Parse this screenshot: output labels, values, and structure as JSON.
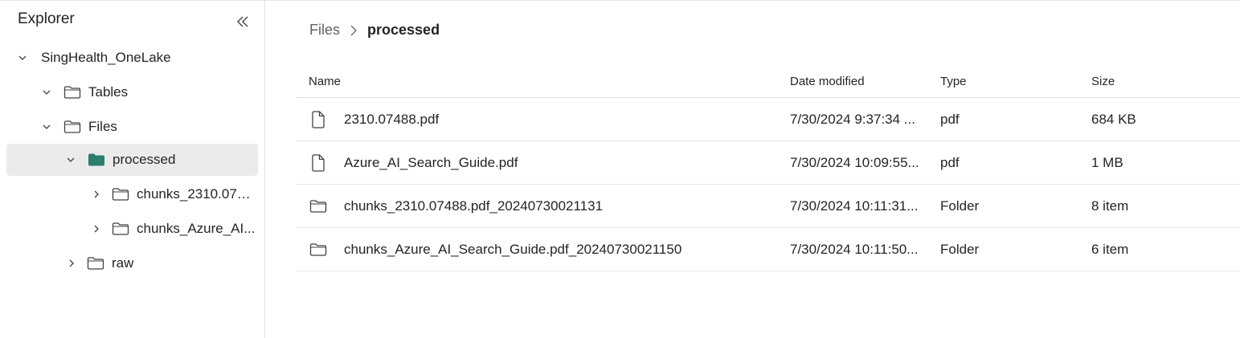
{
  "sidebar": {
    "title": "Explorer",
    "tree": [
      {
        "label": "SingHealth_OneLake",
        "expanded": true,
        "kind": "workspace"
      },
      {
        "label": "Tables",
        "expanded": true,
        "kind": "folder"
      },
      {
        "label": "Files",
        "expanded": true,
        "kind": "folder"
      },
      {
        "label": "processed",
        "expanded": true,
        "kind": "folder-filled",
        "selected": true
      },
      {
        "label": "chunks_2310.074...",
        "expanded": false,
        "kind": "folder"
      },
      {
        "label": "chunks_Azure_AI...",
        "expanded": false,
        "kind": "folder"
      },
      {
        "label": "raw",
        "expanded": false,
        "kind": "folder"
      }
    ]
  },
  "breadcrumb": {
    "root": "Files",
    "current": "processed"
  },
  "table": {
    "headers": {
      "name": "Name",
      "date": "Date modified",
      "type": "Type",
      "size": "Size"
    },
    "rows": [
      {
        "icon": "file-icon",
        "name": "2310.07488.pdf",
        "date": "7/30/2024 9:37:34 ...",
        "type": "pdf",
        "size": "684 KB"
      },
      {
        "icon": "file-icon",
        "name": "Azure_AI_Search_Guide.pdf",
        "date": "7/30/2024 10:09:55...",
        "type": "pdf",
        "size": "1 MB"
      },
      {
        "icon": "folder-icon",
        "name": "chunks_2310.07488.pdf_20240730021131",
        "date": "7/30/2024 10:11:31...",
        "type": "Folder",
        "size": "8 item"
      },
      {
        "icon": "folder-icon",
        "name": "chunks_Azure_AI_Search_Guide.pdf_20240730021150",
        "date": "7/30/2024 10:11:50...",
        "type": "Folder",
        "size": "6 item"
      }
    ]
  },
  "colors": {
    "selected_bg": "#ebebeb",
    "accent_folder": "#2d7d6b",
    "border": "#e0e0e0"
  }
}
